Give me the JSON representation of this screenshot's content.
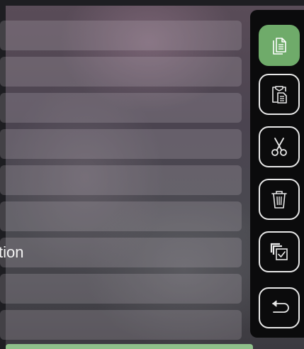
{
  "list": {
    "rows": [
      {
        "label": ""
      },
      {
        "label": ""
      },
      {
        "label": ""
      },
      {
        "label": ""
      },
      {
        "label": ""
      },
      {
        "label": ""
      },
      {
        "label": "tion"
      },
      {
        "label": ""
      },
      {
        "label": ""
      }
    ]
  },
  "toolbar": {
    "buttons": [
      {
        "name": "copy-button",
        "icon": "copy-icon",
        "active": true
      },
      {
        "name": "paste-button",
        "icon": "clipboard-paste-icon",
        "active": false
      },
      {
        "name": "cut-button",
        "icon": "scissors-icon",
        "active": false
      },
      {
        "name": "delete-button",
        "icon": "trash-icon",
        "active": false
      },
      {
        "name": "select-all-button",
        "icon": "select-all-icon",
        "active": false
      },
      {
        "name": "back-button",
        "icon": "back-arrow-icon",
        "active": false
      }
    ]
  },
  "colors": {
    "accent": "#6fab6a",
    "toolbar_bg": "#0b0b0c",
    "icon_stroke": "#e8e8e8"
  }
}
